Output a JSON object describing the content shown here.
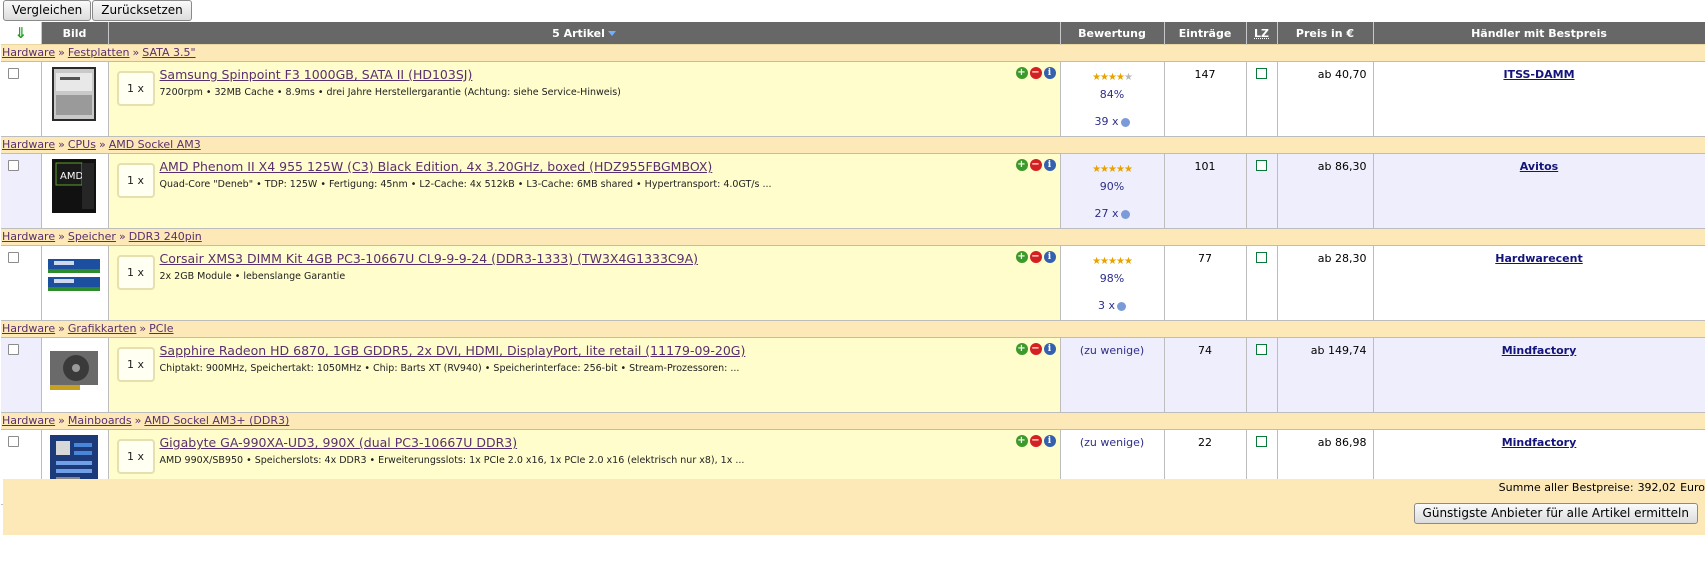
{
  "toolbar": {
    "compare_label": "Vergleichen",
    "reset_label": "Zurücksetzen"
  },
  "columns": {
    "image": "Bild",
    "articles": "5 Artikel",
    "rating": "Bewertung",
    "entries": "Einträge",
    "lz": "LZ",
    "price": "Preis in €",
    "dealer": "Händler mit Bestpreis"
  },
  "products": [
    {
      "crumbs": [
        "Hardware",
        "Festplatten",
        "SATA 3.5\""
      ],
      "qty": "1 x",
      "title": "Samsung Spinpoint F3 1000GB, SATA II (HD103SJ)",
      "desc": "7200rpm • 32MB Cache • 8.9ms • drei Jahre Herstellergarantie (Achtung: siehe Service-Hinweis)",
      "stars": 4,
      "rating_pct": "84%",
      "votes": "39 x",
      "entries": "147",
      "price": "ab 40,70",
      "dealer": "ITSS-DAMM"
    },
    {
      "crumbs": [
        "Hardware",
        "CPUs",
        "AMD Sockel AM3"
      ],
      "qty": "1 x",
      "title": "AMD Phenom II X4 955 125W (C3) Black Edition, 4x 3.20GHz, boxed (HDZ955FBGMBOX)",
      "desc": "Quad-Core \"Deneb\" • TDP: 125W • Fertigung: 45nm • L2-Cache: 4x 512kB • L3-Cache: 6MB shared • Hypertransport: 4.0GT/s ...",
      "stars": 5,
      "rating_pct": "90%",
      "votes": "27 x",
      "entries": "101",
      "price": "ab 86,30",
      "dealer": "Avitos"
    },
    {
      "crumbs": [
        "Hardware",
        "Speicher",
        "DDR3 240pin"
      ],
      "qty": "1 x",
      "title": "Corsair XMS3 DIMM Kit 4GB PC3-10667U CL9-9-9-24 (DDR3-1333) (TW3X4G1333C9A)",
      "desc": "2x 2GB Module • lebenslange Garantie",
      "stars": 5,
      "rating_pct": "98%",
      "votes": "3 x",
      "entries": "77",
      "price": "ab 28,30",
      "dealer": "Hardwarecent"
    },
    {
      "crumbs": [
        "Hardware",
        "Grafikkarten",
        "PCIe"
      ],
      "qty": "1 x",
      "title": "Sapphire Radeon HD 6870, 1GB GDDR5, 2x DVI, HDMI, DisplayPort, lite retail (11179-09-20G)",
      "desc": "Chiptakt: 900MHz, Speichertakt: 1050MHz • Chip: Barts XT (RV940) • Speicherinterface: 256-bit • Stream-Prozessoren: ...",
      "rating_text": "(zu wenige)",
      "entries": "74",
      "price": "ab 149,74",
      "dealer": "Mindfactory"
    },
    {
      "crumbs": [
        "Hardware",
        "Mainboards",
        "AMD Sockel AM3+ (DDR3)"
      ],
      "qty": "1 x",
      "title": "Gigabyte GA-990XA-UD3, 990X (dual PC3-10667U DDR3)",
      "desc": "AMD 990X/SB950 • Speicherslots: 4x DDR3 • Erweiterungsslots: 1x PCIe 2.0 x16, 1x PCIe 2.0 x16 (elektrisch nur x8), 1x ...",
      "rating_text": "(zu wenige)",
      "entries": "22",
      "price": "ab 86,98",
      "dealer": "Mindfactory"
    }
  ],
  "footer": {
    "sum_label": "Summe aller Bestpreise:",
    "sum_value": "392,02",
    "sum_currency": "Euro",
    "find_button": "Günstigste Anbieter für alle Artikel ermitteln"
  }
}
